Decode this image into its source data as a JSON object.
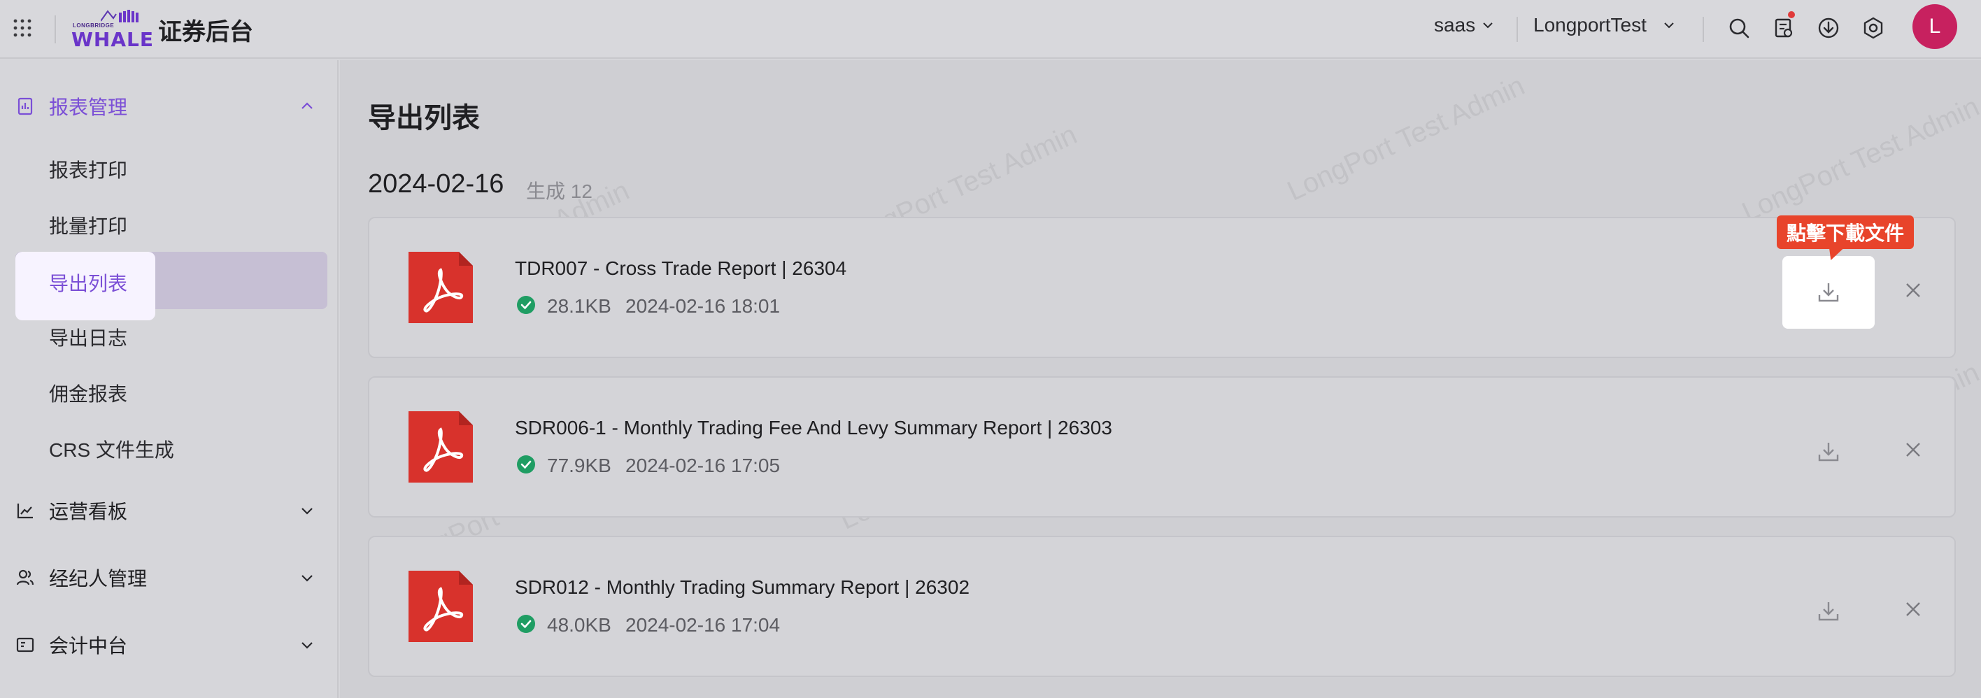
{
  "header": {
    "logo_small": "LONGBRIDGE",
    "logo_main": "WHALE",
    "app_title": "证券后台",
    "tenant": "saas",
    "account": "LongportTest",
    "avatar_initial": "L"
  },
  "sidebar": {
    "groups": [
      {
        "label": "报表管理",
        "expanded": true
      },
      {
        "label": "运营看板",
        "expanded": false
      },
      {
        "label": "经纪人管理",
        "expanded": false
      },
      {
        "label": "会计中台",
        "expanded": false
      }
    ],
    "sub_items": [
      "报表打印",
      "批量打印",
      "导出列表",
      "导出日志",
      "佣金报表",
      "CRS 文件生成"
    ],
    "active_item": "导出列表"
  },
  "main": {
    "page_title": "导出列表",
    "date": "2024-02-16",
    "date_sub": "生成 12",
    "files": [
      {
        "name": "TDR007 - Cross Trade Report | 26304",
        "size": "28.1KB",
        "time": "2024-02-16 18:01"
      },
      {
        "name": "SDR006-1 - Monthly Trading Fee And Levy Summary Report | 26303",
        "size": "77.9KB",
        "time": "2024-02-16 17:05"
      },
      {
        "name": "SDR012 - Monthly Trading Summary Report | 26302",
        "size": "48.0KB",
        "time": "2024-02-16 17:04"
      }
    ],
    "tooltip": "點擊下載文件",
    "watermark": "LongPort Test Admin"
  },
  "colors": {
    "accent": "#7b4fd6",
    "pdf_red": "#d8322c",
    "success": "#1f9d63",
    "tooltip": "#e8442b",
    "avatar": "#c7215f"
  }
}
